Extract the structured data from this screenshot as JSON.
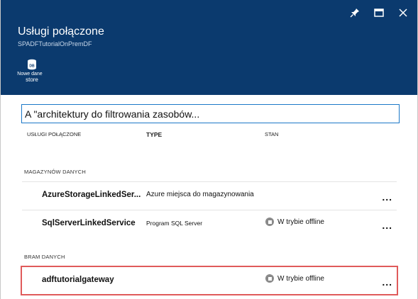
{
  "header": {
    "title": "Usługi połączone",
    "subtitle": "SPADFTutorialOnPremDF",
    "command": {
      "icon": "database-icon",
      "line1": "Nowe dane",
      "line2": "store"
    }
  },
  "window_controls": [
    "pin-icon",
    "maximize-icon",
    "close-icon"
  ],
  "filter": {
    "value": "A \"architektury do filtrowania zasobów..."
  },
  "columns": {
    "name": "USŁUGI POŁĄCZONE",
    "type": "TYPE",
    "status": "STAN"
  },
  "sections": [
    {
      "label": "MAGAZYNÓW DANYCH",
      "rows": [
        {
          "name": "AzureStorageLinkedSer...",
          "type": "Azure miejsca do magazynowania",
          "status": "",
          "more": "..."
        },
        {
          "name": "SqlServerLinkedService",
          "type": "Program SQL Server",
          "status": "W trybie offline",
          "more": "..."
        }
      ]
    },
    {
      "label": "BRAM DANYCH",
      "rows": [
        {
          "name": "adftutorialgateway",
          "type": "",
          "status": "W trybie offline",
          "more": "..."
        }
      ]
    }
  ],
  "colors": {
    "header_bg": "#0b3a6e",
    "filter_border": "#1b78c8",
    "highlight": "#e05b5b",
    "status_offline": "#8a8a8a"
  }
}
